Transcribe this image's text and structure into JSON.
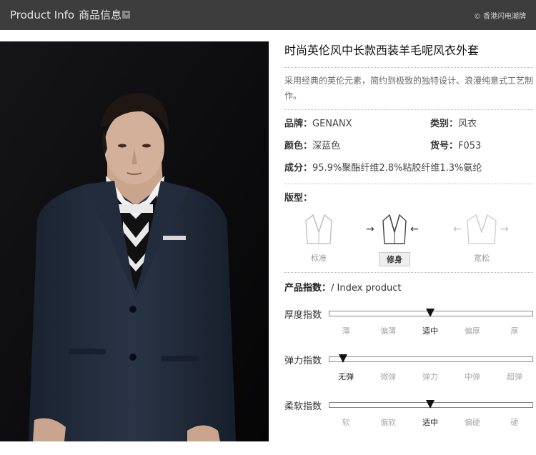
{
  "header": {
    "title_en": "Product Info",
    "title_cn": "商品信息",
    "brand": "© 香港闪电潮牌"
  },
  "product": {
    "title": "时尚英伦风中长款西装羊毛呢风衣外套",
    "description": "采用经典的英伦元素，简约到极致的独特设计、浪漫纯意式工艺制作。",
    "brand_label": "品牌：",
    "brand_value": "GENANX",
    "category_label": "类别：",
    "category_value": "风衣",
    "color_label": "颜色：",
    "color_value": "深蓝色",
    "sku_label": "货号：",
    "sku_value": "F053",
    "material_label": "成分：",
    "material_value": "95.9%聚酯纤维2.8%粘胶纤维1.3%氨纶"
  },
  "fit": {
    "label": "版型：",
    "options": [
      "标准",
      "修身",
      "宽松"
    ],
    "selected": "修身"
  },
  "index": {
    "label": "产品指数：",
    "label_en": "/ Index product",
    "scales": [
      {
        "name": "厚度指数",
        "ticks": [
          "薄",
          "偏薄",
          "适中",
          "偏厚",
          "厚"
        ],
        "selected_index": 2,
        "level": 0.5
      },
      {
        "name": "弹力指数",
        "ticks": [
          "无弹",
          "微弹",
          "弹力",
          "中弹",
          "超弹"
        ],
        "selected_index": 0,
        "level": 0.07
      },
      {
        "name": "柔软指数",
        "ticks": [
          "软",
          "偏软",
          "适中",
          "偏硬",
          "硬"
        ],
        "selected_index": 2,
        "level": 0.5
      }
    ]
  },
  "colors": {
    "header_bg": "#3d3d3d",
    "photo_bg": "#0b0b0d",
    "suit": "#1f2838"
  }
}
